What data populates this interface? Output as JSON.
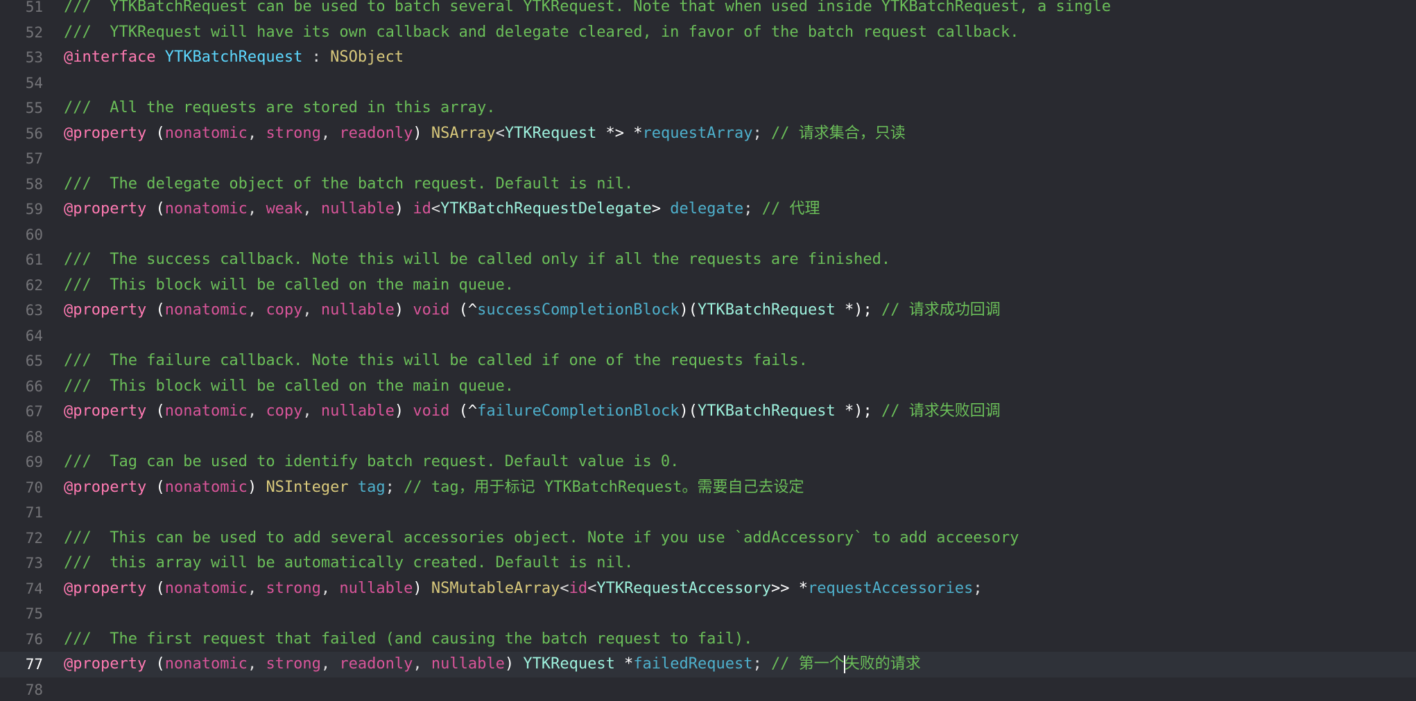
{
  "editor": {
    "language": "Objective-C",
    "current_line": 77,
    "colors": {
      "background": "#292a30",
      "current_line_background": "#2f3239",
      "line_number": "#747478",
      "doc_comment": "#6bbf59",
      "keyword": "#ff7ab2",
      "class_name": "#5dd8ff",
      "property_name": "#4eb0cc"
    },
    "lines": [
      {
        "number": "51",
        "tokens": [
          {
            "text": "///  YTKBatchRequest can be used to batch several YTKRequest. Note that when used inside YTKBatchRequest, a single",
            "type": "doc"
          }
        ]
      },
      {
        "number": "52",
        "tokens": [
          {
            "text": "///  YTKRequest will have its own callback and delegate cleared, in favor of the batch request callback.",
            "type": "doc"
          }
        ]
      },
      {
        "number": "53",
        "tokens": [
          {
            "text": "@interface",
            "type": "kw"
          },
          {
            "text": " ",
            "type": "plain"
          },
          {
            "text": "YTKBatchRequest",
            "type": "class"
          },
          {
            "text": " : ",
            "type": "plain"
          },
          {
            "text": "NSObject",
            "type": "typeY"
          }
        ]
      },
      {
        "number": "54",
        "tokens": []
      },
      {
        "number": "55",
        "tokens": [
          {
            "text": "///  All the requests are stored in this array.",
            "type": "doc"
          }
        ]
      },
      {
        "number": "56",
        "tokens": [
          {
            "text": "@property",
            "type": "kw"
          },
          {
            "text": " (",
            "type": "bracket"
          },
          {
            "text": "nonatomic",
            "type": "attr"
          },
          {
            "text": ", ",
            "type": "plain"
          },
          {
            "text": "strong",
            "type": "attr"
          },
          {
            "text": ", ",
            "type": "plain"
          },
          {
            "text": "readonly",
            "type": "attr"
          },
          {
            "text": ") ",
            "type": "bracket"
          },
          {
            "text": "NSArray",
            "type": "typeY"
          },
          {
            "text": "<",
            "type": "plain"
          },
          {
            "text": "YTKRequest",
            "type": "typeT"
          },
          {
            "text": " *> *",
            "type": "bracket"
          },
          {
            "text": "requestArray",
            "type": "ivar"
          },
          {
            "text": "; ",
            "type": "plain"
          },
          {
            "text": "// 请求集合，只读",
            "type": "comment"
          }
        ]
      },
      {
        "number": "57",
        "tokens": []
      },
      {
        "number": "58",
        "tokens": [
          {
            "text": "///  The delegate object of the batch request. Default is nil.",
            "type": "doc"
          }
        ]
      },
      {
        "number": "59",
        "tokens": [
          {
            "text": "@property",
            "type": "kw"
          },
          {
            "text": " (",
            "type": "bracket"
          },
          {
            "text": "nonatomic",
            "type": "attr"
          },
          {
            "text": ", ",
            "type": "plain"
          },
          {
            "text": "weak",
            "type": "attr"
          },
          {
            "text": ", ",
            "type": "plain"
          },
          {
            "text": "nullable",
            "type": "attr"
          },
          {
            "text": ") ",
            "type": "bracket"
          },
          {
            "text": "id",
            "type": "attr"
          },
          {
            "text": "<",
            "type": "plain"
          },
          {
            "text": "YTKBatchRequestDelegate",
            "type": "typeT"
          },
          {
            "text": "> ",
            "type": "bracket"
          },
          {
            "text": "delegate",
            "type": "ivar"
          },
          {
            "text": "; ",
            "type": "plain"
          },
          {
            "text": "// 代理",
            "type": "comment"
          }
        ]
      },
      {
        "number": "60",
        "tokens": []
      },
      {
        "number": "61",
        "tokens": [
          {
            "text": "///  The success callback. Note this will be called only if all the requests are finished.",
            "type": "doc"
          }
        ]
      },
      {
        "number": "62",
        "tokens": [
          {
            "text": "///  This block will be called on the main queue.",
            "type": "doc"
          }
        ]
      },
      {
        "number": "63",
        "tokens": [
          {
            "text": "@property",
            "type": "kw"
          },
          {
            "text": " (",
            "type": "bracket"
          },
          {
            "text": "nonatomic",
            "type": "attr"
          },
          {
            "text": ", ",
            "type": "plain"
          },
          {
            "text": "copy",
            "type": "attr"
          },
          {
            "text": ", ",
            "type": "plain"
          },
          {
            "text": "nullable",
            "type": "attr"
          },
          {
            "text": ") ",
            "type": "bracket"
          },
          {
            "text": "void",
            "type": "attr"
          },
          {
            "text": " (^",
            "type": "bracket"
          },
          {
            "text": "successCompletionBlock",
            "type": "ivar"
          },
          {
            "text": ")(",
            "type": "bracket"
          },
          {
            "text": "YTKBatchRequest",
            "type": "typeT"
          },
          {
            "text": " *); ",
            "type": "bracket"
          },
          {
            "text": "// 请求成功回调",
            "type": "comment"
          }
        ]
      },
      {
        "number": "64",
        "tokens": []
      },
      {
        "number": "65",
        "tokens": [
          {
            "text": "///  The failure callback. Note this will be called if one of the requests fails.",
            "type": "doc"
          }
        ]
      },
      {
        "number": "66",
        "tokens": [
          {
            "text": "///  This block will be called on the main queue.",
            "type": "doc"
          }
        ]
      },
      {
        "number": "67",
        "tokens": [
          {
            "text": "@property",
            "type": "kw"
          },
          {
            "text": " (",
            "type": "bracket"
          },
          {
            "text": "nonatomic",
            "type": "attr"
          },
          {
            "text": ", ",
            "type": "plain"
          },
          {
            "text": "copy",
            "type": "attr"
          },
          {
            "text": ", ",
            "type": "plain"
          },
          {
            "text": "nullable",
            "type": "attr"
          },
          {
            "text": ") ",
            "type": "bracket"
          },
          {
            "text": "void",
            "type": "attr"
          },
          {
            "text": " (^",
            "type": "bracket"
          },
          {
            "text": "failureCompletionBlock",
            "type": "ivar"
          },
          {
            "text": ")(",
            "type": "bracket"
          },
          {
            "text": "YTKBatchRequest",
            "type": "typeT"
          },
          {
            "text": " *); ",
            "type": "bracket"
          },
          {
            "text": "// 请求失败回调",
            "type": "comment"
          }
        ]
      },
      {
        "number": "68",
        "tokens": []
      },
      {
        "number": "69",
        "tokens": [
          {
            "text": "///  Tag can be used to identify batch request. Default value is 0.",
            "type": "doc"
          }
        ]
      },
      {
        "number": "70",
        "tokens": [
          {
            "text": "@property",
            "type": "kw"
          },
          {
            "text": " (",
            "type": "bracket"
          },
          {
            "text": "nonatomic",
            "type": "attr"
          },
          {
            "text": ") ",
            "type": "bracket"
          },
          {
            "text": "NSInteger",
            "type": "typeY"
          },
          {
            "text": " ",
            "type": "plain"
          },
          {
            "text": "tag",
            "type": "ivar"
          },
          {
            "text": "; ",
            "type": "plain"
          },
          {
            "text": "// tag，用于标记 YTKBatchRequest。需要自己去设定",
            "type": "comment"
          }
        ]
      },
      {
        "number": "71",
        "tokens": []
      },
      {
        "number": "72",
        "tokens": [
          {
            "text": "///  This can be used to add several accessories object. Note if you use `addAccessory` to add acceesory",
            "type": "doc"
          }
        ]
      },
      {
        "number": "73",
        "tokens": [
          {
            "text": "///  this array will be automatically created. Default is nil.",
            "type": "doc"
          }
        ]
      },
      {
        "number": "74",
        "tokens": [
          {
            "text": "@property",
            "type": "kw"
          },
          {
            "text": " (",
            "type": "bracket"
          },
          {
            "text": "nonatomic",
            "type": "attr"
          },
          {
            "text": ", ",
            "type": "plain"
          },
          {
            "text": "strong",
            "type": "attr"
          },
          {
            "text": ", ",
            "type": "plain"
          },
          {
            "text": "nullable",
            "type": "attr"
          },
          {
            "text": ") ",
            "type": "bracket"
          },
          {
            "text": "NSMutableArray",
            "type": "typeY"
          },
          {
            "text": "<",
            "type": "plain"
          },
          {
            "text": "id",
            "type": "attr"
          },
          {
            "text": "<",
            "type": "plain"
          },
          {
            "text": "YTKRequestAccessory",
            "type": "typeT"
          },
          {
            "text": ">> *",
            "type": "bracket"
          },
          {
            "text": "requestAccessories",
            "type": "ivar"
          },
          {
            "text": ";",
            "type": "plain"
          }
        ]
      },
      {
        "number": "75",
        "tokens": []
      },
      {
        "number": "76",
        "tokens": [
          {
            "text": "///  The first request that failed (and causing the batch request to fail).",
            "type": "doc"
          }
        ]
      },
      {
        "number": "77",
        "tokens": [
          {
            "text": "@property",
            "type": "kw"
          },
          {
            "text": " (",
            "type": "bracket"
          },
          {
            "text": "nonatomic",
            "type": "attr"
          },
          {
            "text": ", ",
            "type": "plain"
          },
          {
            "text": "strong",
            "type": "attr"
          },
          {
            "text": ", ",
            "type": "plain"
          },
          {
            "text": "readonly",
            "type": "attr"
          },
          {
            "text": ", ",
            "type": "plain"
          },
          {
            "text": "nullable",
            "type": "attr"
          },
          {
            "text": ") ",
            "type": "bracket"
          },
          {
            "text": "YTKRequest",
            "type": "typeT"
          },
          {
            "text": " *",
            "type": "bracket"
          },
          {
            "text": "failedRequest",
            "type": "ivar"
          },
          {
            "text": "; ",
            "type": "plain"
          },
          {
            "text": "// 第一个",
            "type": "comment"
          },
          {
            "text": "",
            "type": "caret"
          },
          {
            "text": "失败的请求",
            "type": "comment"
          }
        ]
      },
      {
        "number": "78",
        "tokens": []
      }
    ]
  }
}
